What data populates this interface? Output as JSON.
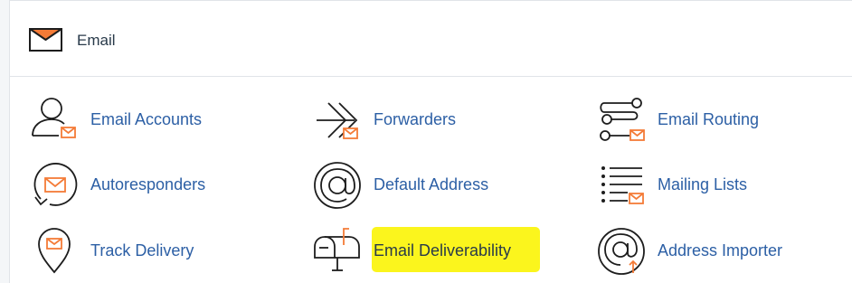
{
  "section": {
    "title": "Email",
    "icon": "envelope-icon"
  },
  "colors": {
    "link": "#2c5fa5",
    "accent": "#f47b37",
    "highlight": "#fbf51d"
  },
  "items": [
    {
      "label": "Email Accounts",
      "icon": "user-mail-icon"
    },
    {
      "label": "Forwarders",
      "icon": "forward-arrows-icon"
    },
    {
      "label": "Email Routing",
      "icon": "routing-icon"
    },
    {
      "label": "Autoresponders",
      "icon": "autoresponder-icon"
    },
    {
      "label": "Default Address",
      "icon": "at-sign-icon"
    },
    {
      "label": "Mailing Lists",
      "icon": "mailing-list-icon"
    },
    {
      "label": "Track Delivery",
      "icon": "location-pin-mail-icon"
    },
    {
      "label": "Email Deliverability",
      "icon": "mailbox-icon",
      "highlighted": true
    },
    {
      "label": "Address Importer",
      "icon": "at-import-icon"
    }
  ]
}
